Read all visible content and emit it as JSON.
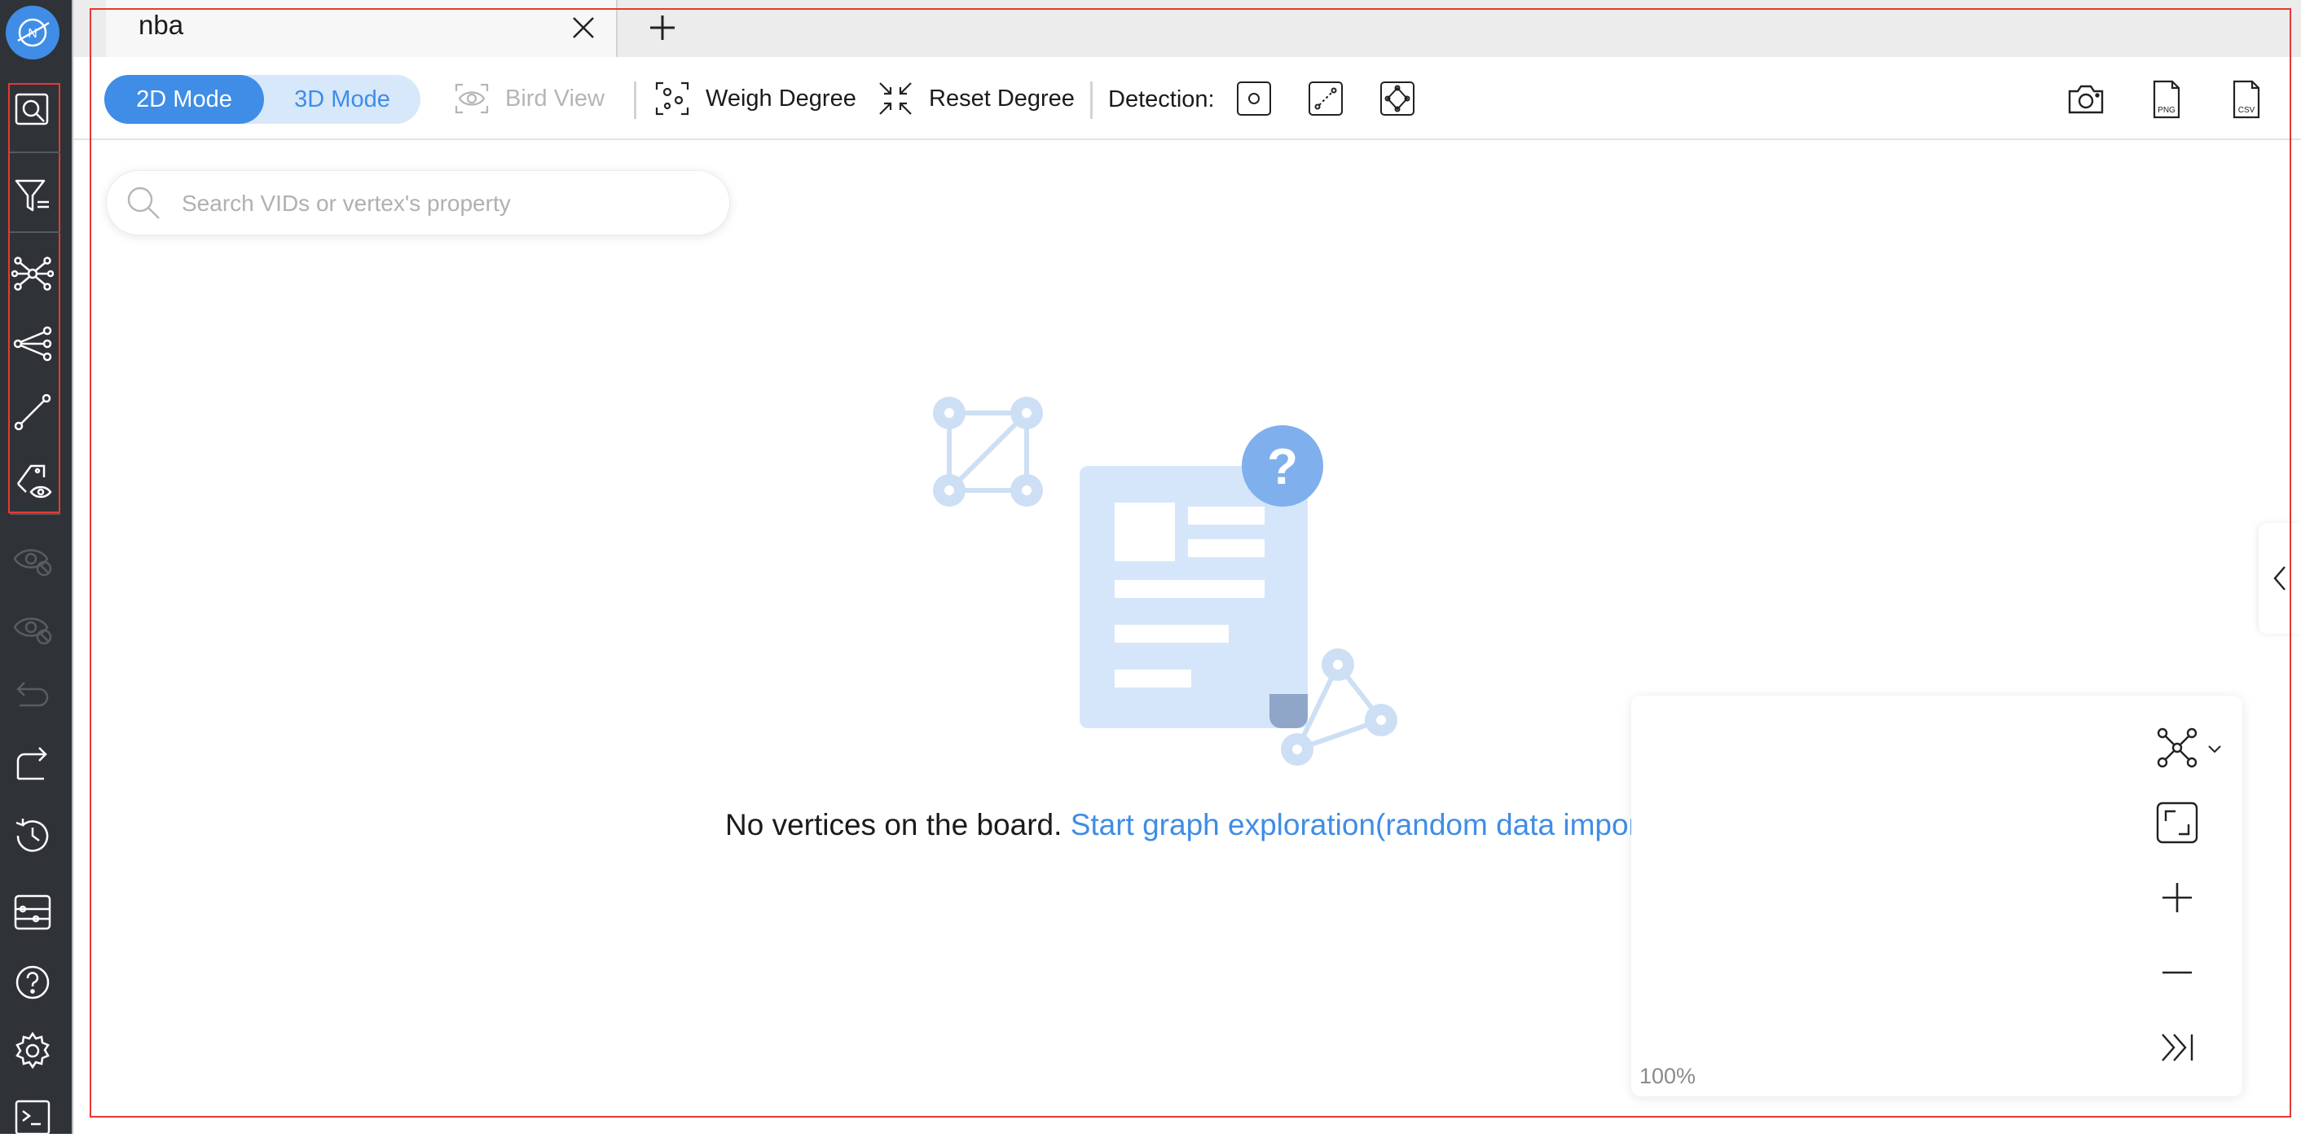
{
  "app": {
    "logo_letter": "N"
  },
  "tabs": [
    {
      "title": "nba"
    }
  ],
  "toolbar": {
    "mode_2d": "2D Mode",
    "mode_3d": "3D Mode",
    "bird_view": "Bird View",
    "weigh_degree": "Weigh Degree",
    "reset_degree": "Reset Degree",
    "detection_label": "Detection:"
  },
  "search": {
    "placeholder": "Search VIDs or vertex's property"
  },
  "empty_state": {
    "message": "No vertices on the board.",
    "link": "Start graph exploration(random data import)"
  },
  "zoom": {
    "level": "100%"
  },
  "icons": {
    "sidebar": [
      "search-icon",
      "filter-icon",
      "expand-icon",
      "common-neighbor-icon",
      "path-icon",
      "show-hide-property-icon",
      "hide-vertices-icon",
      "hide-edges-icon",
      "undo-icon",
      "redo-icon",
      "history-icon",
      "graph-settings-icon",
      "help-icon",
      "settings-icon",
      "console-icon"
    ],
    "toolbar": [
      "eye-icon",
      "weigh-degree-icon",
      "reset-degree-icon",
      "detection-vertex-icon",
      "detection-edge-icon",
      "detection-diamond-icon",
      "camera-icon",
      "png-icon",
      "csv-icon"
    ],
    "zoom_panel": [
      "layout-icon",
      "fit-icon",
      "zoom-in-icon",
      "zoom-out-icon",
      "collapse-icon"
    ]
  },
  "colors": {
    "accent": "#3f8de6",
    "sidebar_bg": "#2f3337",
    "outline": "#e53935"
  },
  "export": {
    "png": "PNG",
    "csv": "CSV"
  }
}
